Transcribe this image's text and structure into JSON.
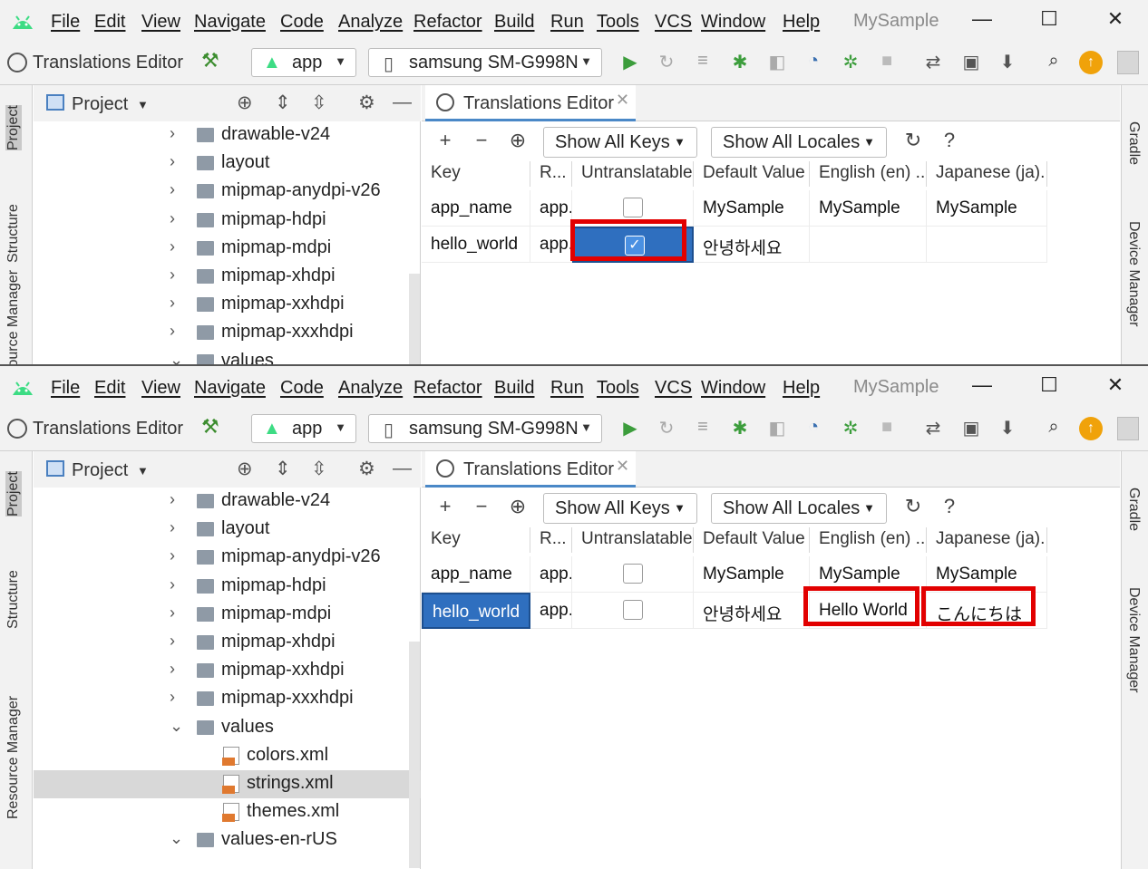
{
  "menu": {
    "items": [
      "File",
      "Edit",
      "View",
      "Navigate",
      "Code",
      "Analyze",
      "Refactor",
      "Build",
      "Run",
      "Tools",
      "VCS",
      "Window",
      "Help"
    ],
    "project_title": "MySample",
    "minimize": "—",
    "maximize": "☐",
    "close": "✕"
  },
  "toolbar": {
    "context_title": "Translations Editor",
    "module": "app",
    "device": "samsung SM-G998N"
  },
  "sidebar": {
    "left_tabs": [
      "Project",
      "Structure",
      "Resource Manager"
    ],
    "right_tabs": [
      "Gradle",
      "Device Manager"
    ]
  },
  "project_panel": {
    "title": "Project",
    "tree_top": [
      {
        "label": "drawable-v24",
        "expanded": false
      },
      {
        "label": "layout",
        "expanded": false
      },
      {
        "label": "mipmap-anydpi-v26",
        "expanded": false
      },
      {
        "label": "mipmap-hdpi",
        "expanded": false
      },
      {
        "label": "mipmap-mdpi",
        "expanded": false
      },
      {
        "label": "mipmap-xhdpi",
        "expanded": false
      },
      {
        "label": "mipmap-xxhdpi",
        "expanded": false
      },
      {
        "label": "mipmap-xxxhdpi",
        "expanded": false
      },
      {
        "label": "values",
        "expanded": true
      }
    ],
    "tree_bottom": [
      {
        "label": "drawable-v24",
        "type": "folder"
      },
      {
        "label": "layout",
        "type": "folder"
      },
      {
        "label": "mipmap-anydpi-v26",
        "type": "folder"
      },
      {
        "label": "mipmap-hdpi",
        "type": "folder"
      },
      {
        "label": "mipmap-mdpi",
        "type": "folder"
      },
      {
        "label": "mipmap-xhdpi",
        "type": "folder"
      },
      {
        "label": "mipmap-xxhdpi",
        "type": "folder"
      },
      {
        "label": "mipmap-xxxhdpi",
        "type": "folder"
      },
      {
        "label": "values",
        "type": "folder-open"
      },
      {
        "label": "colors.xml",
        "type": "xml"
      },
      {
        "label": "strings.xml",
        "type": "xml",
        "selected": true
      },
      {
        "label": "themes.xml",
        "type": "xml"
      },
      {
        "label": "values-en-rUS",
        "type": "folder-open"
      }
    ]
  },
  "editor": {
    "tab_label": "Translations Editor",
    "filter_keys": "Show All Keys",
    "filter_locales": "Show All Locales",
    "help": "?",
    "columns": [
      "Key",
      "R...",
      "Untranslatable",
      "Default Value",
      "English (en) ...",
      "Japanese (ja)..."
    ],
    "before": {
      "rows": [
        {
          "key": "app_name",
          "resource": "app.",
          "untranslatable": false,
          "default": "MySample",
          "en": "MySample",
          "ja": "MySample"
        },
        {
          "key": "hello_world",
          "resource": "app.",
          "untranslatable": true,
          "default": "안녕하세요",
          "en": "",
          "ja": ""
        }
      ]
    },
    "after": {
      "rows": [
        {
          "key": "app_name",
          "resource": "app.",
          "untranslatable": false,
          "default": "MySample",
          "en": "MySample",
          "ja": "MySample"
        },
        {
          "key": "hello_world",
          "resource": "app.",
          "untranslatable": false,
          "default": "안녕하세요",
          "en": "Hello World",
          "ja": "こんにちは"
        }
      ]
    }
  },
  "colors": {
    "highlight": "#e20000",
    "selection": "#2f6fbf",
    "android_green": "#3ddc84"
  }
}
